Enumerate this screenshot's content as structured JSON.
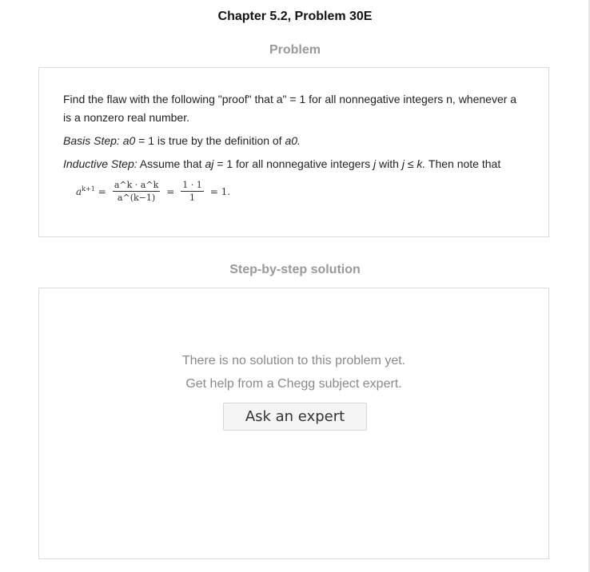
{
  "header": {
    "title": "Chapter 5.2, Problem 30E"
  },
  "problem": {
    "label": "Problem",
    "statement": "Find the flaw with the following \"proof\" that a\" = 1 for all nonnegative integers n, whenever a is a nonzero real number.",
    "basis_label": "Basis Step:",
    "basis_a": "a0",
    "basis_mid": " = 1 is true by the definition of ",
    "basis_b": "a0.",
    "inductive_label": "Inductive Step:",
    "inductive_p1": " Assume that ",
    "inductive_aj": "aj",
    "inductive_p2": " = 1 for all nonnegative integers ",
    "inductive_j": "j",
    "inductive_p3": " with ",
    "inductive_cond": "j ≤ k.",
    "inductive_p4": " Then note that",
    "formula": {
      "lhs_base": "a",
      "lhs_exp": "k+1",
      "eq": "=",
      "frac1_num": "a^k · a^k",
      "frac1_den": "a^(k−1)",
      "frac2_num": "1 · 1",
      "frac2_den": "1",
      "result": "= 1."
    }
  },
  "solution": {
    "label": "Step-by-step solution",
    "no_solution_line1": "There is no solution to this problem yet.",
    "no_solution_line2": "Get help from a Chegg subject expert.",
    "ask_button": "Ask an expert"
  }
}
